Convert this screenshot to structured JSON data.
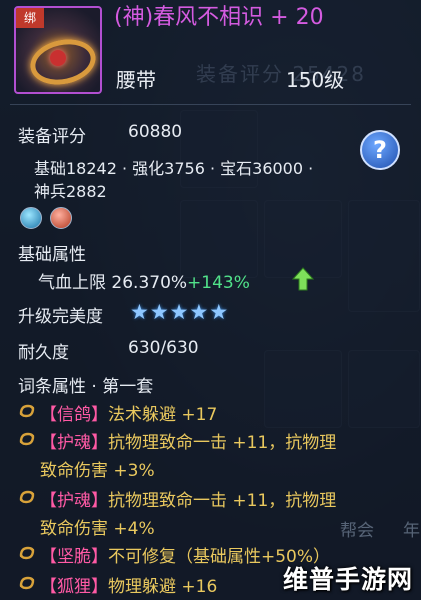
{
  "item": {
    "bind_tag": "绑",
    "name": "(神)春风不相识 + 20",
    "slot": "腰带",
    "level": "150级",
    "bg_ghost_text": "装备评分 25428"
  },
  "score": {
    "label": "装备评分",
    "value": "60880"
  },
  "breakdown": {
    "line1": "基础18242 · 强化3756 · 宝石36000 ·",
    "line2": "神兵2882"
  },
  "help": {
    "label": "?"
  },
  "gems": [
    {
      "icon": "blue-gem-icon"
    },
    {
      "icon": "red-gem-icon"
    }
  ],
  "base_attr": {
    "title": "基础属性",
    "stat": "气血上限 26.370%",
    "bonus": "+143%"
  },
  "upgrade": {
    "label": "升级完美度",
    "stars": 5
  },
  "durability": {
    "label": "耐久度",
    "value": "630/630"
  },
  "affixes": {
    "title": "词条属性 · 第一套",
    "rows": [
      {
        "tag": "【信鸽】",
        "text": "法术躲避 +17",
        "wrap": ""
      },
      {
        "tag": "【护魂】",
        "text": "抗物理致命一击 +11，抗物理",
        "wrap": "致命伤害 +3%"
      },
      {
        "tag": "【护魂】",
        "text": "抗物理致命一击 +11，抗物理",
        "wrap": "致命伤害 +4%"
      },
      {
        "tag": "【坚脆】",
        "text": "不可修复（基础属性+50%）",
        "wrap": ""
      },
      {
        "tag": "【狐狸】",
        "text": "物理躲避 +16",
        "wrap": ""
      }
    ]
  },
  "background_hint": {
    "left": "帮会",
    "right": "年"
  },
  "watermark": "维普手游网",
  "colors": {
    "name_purple": "#d45be0",
    "affix_pink": "#ff5aa5",
    "affix_gold": "#e9c85e",
    "bonus_green": "#51e28a",
    "star_blue": "#8fc7ff"
  }
}
